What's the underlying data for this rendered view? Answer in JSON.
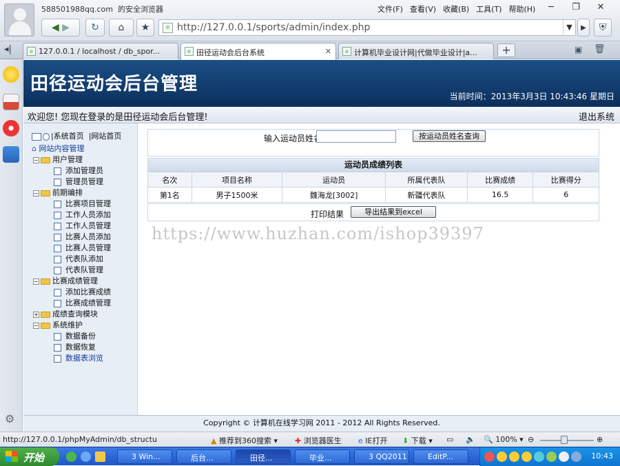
{
  "browser": {
    "account_email": "588501988qq.com",
    "account_label": "的安全浏览器",
    "menu": [
      "文件(F)",
      "查看(V)",
      "收藏(B)",
      "工具(T)",
      "帮助(H)"
    ],
    "address": "http://127.0.0.1/sports/admin/index.php",
    "tabs": [
      {
        "label": "127.0.0.1 / localhost / db_spor..."
      },
      {
        "label": "田径运动会后台系统"
      },
      {
        "label": "计算机毕业设计网|代做毕业设计|a..."
      }
    ],
    "status_url": "http://127.0.0.1/phpMyAdmin/db_structu",
    "status_items": [
      "推荐到360搜索",
      "浏览器医生",
      "IE打开",
      "下载"
    ],
    "zoom": "100%",
    "zoom_level": 0.45
  },
  "page": {
    "title": "田径运动会后台管理",
    "time_label": "当前时间：",
    "time_value": "2013年3月3日  10:43:46 星期日",
    "welcome": "欢迎您! 您现在登录的是田径运动会后台管理!",
    "logout": "退出系统",
    "footer": "Copyright © 计算机在线学习网  2011 - 2012 All Rights Reserved."
  },
  "sidebar": {
    "top_links": [
      "|系统首页",
      "|网站首页"
    ],
    "root": "网站内容管理",
    "groups": [
      {
        "label": "用户管理",
        "items": [
          "添加管理员",
          "管理员管理"
        ]
      },
      {
        "label": "前期编排",
        "items": [
          "比赛项目管理",
          "工作人员添加",
          "工作人员管理",
          "比赛人员添加",
          "比赛人员管理",
          "代表队添加",
          "代表队管理"
        ]
      },
      {
        "label": "比赛成绩管理",
        "items": [
          "添加比赛成绩",
          "比赛成绩管理"
        ]
      },
      {
        "label": "成绩查询模块",
        "items": []
      },
      {
        "label": "系统维护",
        "items": [
          "数据备份",
          "数据恢复",
          "数据表浏览"
        ]
      }
    ]
  },
  "search": {
    "label": "输入运动员姓名:",
    "value": "",
    "button": "按运动员姓名查询"
  },
  "results": {
    "title": "运动员成绩列表",
    "headers": [
      "名次",
      "项目名称",
      "运动员",
      "所属代表队",
      "比赛成绩",
      "比赛得分"
    ],
    "rows": [
      [
        "第1名",
        "男子1500米",
        "魏海龙[3002]",
        "新疆代表队",
        "16.5",
        "6"
      ]
    ],
    "print_label": "打印结果",
    "export_button": "导出结果到excel"
  },
  "watermark": "https://www.huzhan.com/ishop39397",
  "taskbar": {
    "start": "开始",
    "tasks": [
      "3 Win...",
      "后台...",
      "田径...",
      "毕业...",
      "3 QQ2011",
      "EditP..."
    ],
    "clock": "10:43"
  }
}
